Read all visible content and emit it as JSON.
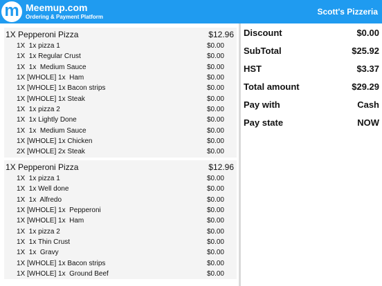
{
  "header": {
    "brand_logo_letter": "m",
    "brand_title": "Meemup.com",
    "brand_subtitle": "Ordering & Payment Platform",
    "store_name": "Scott's Pizzeria",
    "color": "#1f9bf0"
  },
  "orders": [
    {
      "name": "1X Pepperoni Pizza",
      "price": "$12.96",
      "lines": [
        {
          "label": "1X  1x pizza 1",
          "amount": "$0.00"
        },
        {
          "label": "1X  1x Regular Crust",
          "amount": "$0.00"
        },
        {
          "label": "1X  1x  Medium Sauce",
          "amount": "$0.00"
        },
        {
          "label": "1X [WHOLE] 1x  Ham",
          "amount": "$0.00"
        },
        {
          "label": "1X [WHOLE] 1x Bacon strips",
          "amount": "$0.00"
        },
        {
          "label": "1X [WHOLE] 1x Steak",
          "amount": "$0.00"
        },
        {
          "label": "1X  1x pizza 2",
          "amount": "$0.00"
        },
        {
          "label": "1X  1x Lightly Done",
          "amount": "$0.00"
        },
        {
          "label": "1X  1x  Medium Sauce",
          "amount": "$0.00"
        },
        {
          "label": "1X [WHOLE] 1x Chicken",
          "amount": "$0.00"
        },
        {
          "label": "2X [WHOLE] 2x Steak",
          "amount": "$0.00"
        }
      ]
    },
    {
      "name": "1X Pepperoni Pizza",
      "price": "$12.96",
      "lines": [
        {
          "label": "1X  1x pizza 1",
          "amount": "$0.00"
        },
        {
          "label": "1X  1x Well done",
          "amount": "$0.00"
        },
        {
          "label": "1X  1x  Alfredo",
          "amount": "$0.00"
        },
        {
          "label": "1X [WHOLE] 1x  Pepperoni",
          "amount": "$0.00"
        },
        {
          "label": "1X [WHOLE] 1x  Ham",
          "amount": "$0.00"
        },
        {
          "label": "1X  1x pizza 2",
          "amount": "$0.00"
        },
        {
          "label": "1X  1x Thin Crust",
          "amount": "$0.00"
        },
        {
          "label": "1X  1x  Gravy",
          "amount": "$0.00"
        },
        {
          "label": "1X [WHOLE] 1x Bacon strips",
          "amount": "$0.00"
        },
        {
          "label": "1X [WHOLE] 1x  Ground Beef",
          "amount": "$0.00"
        }
      ]
    }
  ],
  "summary": [
    {
      "key": "Discount",
      "value": "$0.00"
    },
    {
      "key": "SubTotal",
      "value": "$25.92"
    },
    {
      "key": "HST",
      "value": "$3.37"
    },
    {
      "key": "Total amount",
      "value": "$29.29"
    },
    {
      "key": "Pay with",
      "value": "Cash"
    },
    {
      "key": "Pay state",
      "value": "NOW"
    }
  ]
}
